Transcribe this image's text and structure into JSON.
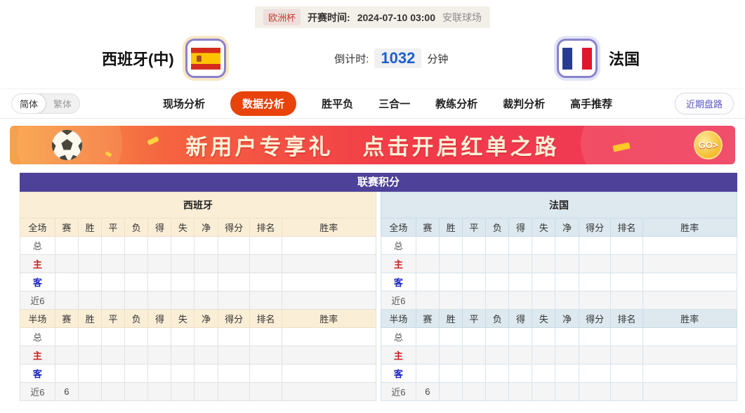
{
  "header": {
    "league_badge": "欧洲杯",
    "kickoff_label": "开赛时间:",
    "kickoff_time": "2024-07-10 03:00",
    "venue": "安联球场",
    "home_team": "西班牙(中)",
    "away_team": "法国",
    "countdown_label": "倒计时:",
    "countdown_value": "1032",
    "countdown_unit": "分钟"
  },
  "nav": {
    "lang_simplified": "简体",
    "lang_traditional": "繁体",
    "tabs": [
      {
        "key": "live-analysis",
        "label": "现场分析",
        "active": false
      },
      {
        "key": "data-analysis",
        "label": "数据分析",
        "active": true
      },
      {
        "key": "win-draw-lose",
        "label": "胜平负",
        "active": false
      },
      {
        "key": "three-in-one",
        "label": "三合一",
        "active": false
      },
      {
        "key": "coach-analysis",
        "label": "教练分析",
        "active": false
      },
      {
        "key": "referee-analysis",
        "label": "裁判分析",
        "active": false
      },
      {
        "key": "expert-picks",
        "label": "高手推荐",
        "active": false
      }
    ],
    "recent_button": "近期盘路"
  },
  "banner": {
    "text_part1": "新用户专享礼",
    "text_part2": "点击开启红单之路",
    "go_label": "GO>"
  },
  "table": {
    "title": "联赛积分",
    "full_label": "全场",
    "half_label": "半场",
    "columns": [
      "赛",
      "胜",
      "平",
      "负",
      "得",
      "失",
      "净",
      "得分",
      "排名",
      "胜率"
    ],
    "sides": [
      {
        "team": "西班牙",
        "theme": "home",
        "full_rows": [
          {
            "label": "总",
            "type": "total",
            "cells": [
              "",
              "",
              "",
              "",
              "",
              "",
              "",
              "",
              "",
              ""
            ]
          },
          {
            "label": "主",
            "type": "home",
            "cells": [
              "",
              "",
              "",
              "",
              "",
              "",
              "",
              "",
              "",
              ""
            ]
          },
          {
            "label": "客",
            "type": "away",
            "cells": [
              "",
              "",
              "",
              "",
              "",
              "",
              "",
              "",
              "",
              ""
            ]
          },
          {
            "label": "近6",
            "type": "recent",
            "cells": [
              "",
              "",
              "",
              "",
              "",
              "",
              "",
              "",
              "",
              ""
            ]
          }
        ],
        "half_rows": [
          {
            "label": "总",
            "type": "total",
            "cells": [
              "",
              "",
              "",
              "",
              "",
              "",
              "",
              "",
              "",
              ""
            ]
          },
          {
            "label": "主",
            "type": "home",
            "cells": [
              "",
              "",
              "",
              "",
              "",
              "",
              "",
              "",
              "",
              ""
            ]
          },
          {
            "label": "客",
            "type": "away",
            "cells": [
              "",
              "",
              "",
              "",
              "",
              "",
              "",
              "",
              "",
              ""
            ]
          },
          {
            "label": "近6",
            "type": "recent",
            "cells": [
              "6",
              "",
              "",
              "",
              "",
              "",
              "",
              "",
              "",
              ""
            ]
          }
        ]
      },
      {
        "team": "法国",
        "theme": "away",
        "full_rows": [
          {
            "label": "总",
            "type": "total",
            "cells": [
              "",
              "",
              "",
              "",
              "",
              "",
              "",
              "",
              "",
              ""
            ]
          },
          {
            "label": "主",
            "type": "home",
            "cells": [
              "",
              "",
              "",
              "",
              "",
              "",
              "",
              "",
              "",
              ""
            ]
          },
          {
            "label": "客",
            "type": "away",
            "cells": [
              "",
              "",
              "",
              "",
              "",
              "",
              "",
              "",
              "",
              ""
            ]
          },
          {
            "label": "近6",
            "type": "recent",
            "cells": [
              "",
              "",
              "",
              "",
              "",
              "",
              "",
              "",
              "",
              ""
            ]
          }
        ],
        "half_rows": [
          {
            "label": "总",
            "type": "total",
            "cells": [
              "",
              "",
              "",
              "",
              "",
              "",
              "",
              "",
              "",
              ""
            ]
          },
          {
            "label": "主",
            "type": "home",
            "cells": [
              "",
              "",
              "",
              "",
              "",
              "",
              "",
              "",
              "",
              ""
            ]
          },
          {
            "label": "客",
            "type": "away",
            "cells": [
              "",
              "",
              "",
              "",
              "",
              "",
              "",
              "",
              "",
              ""
            ]
          },
          {
            "label": "近6",
            "type": "recent",
            "cells": [
              "6",
              "",
              "",
              "",
              "",
              "",
              "",
              "",
              "",
              ""
            ]
          }
        ]
      }
    ]
  },
  "colors": {
    "accent_orange": "#e8430a",
    "table_header_purple": "#4e4199",
    "home_header_cream": "#fbeed6",
    "away_header_blue": "#dde8ef",
    "home_row_red": "#c92020",
    "away_row_blue": "#1d25c0",
    "countdown_blue": "#1c5ed0",
    "banner_gradient_start": "#f8a24c",
    "banner_gradient_end": "#ef3a5c"
  }
}
